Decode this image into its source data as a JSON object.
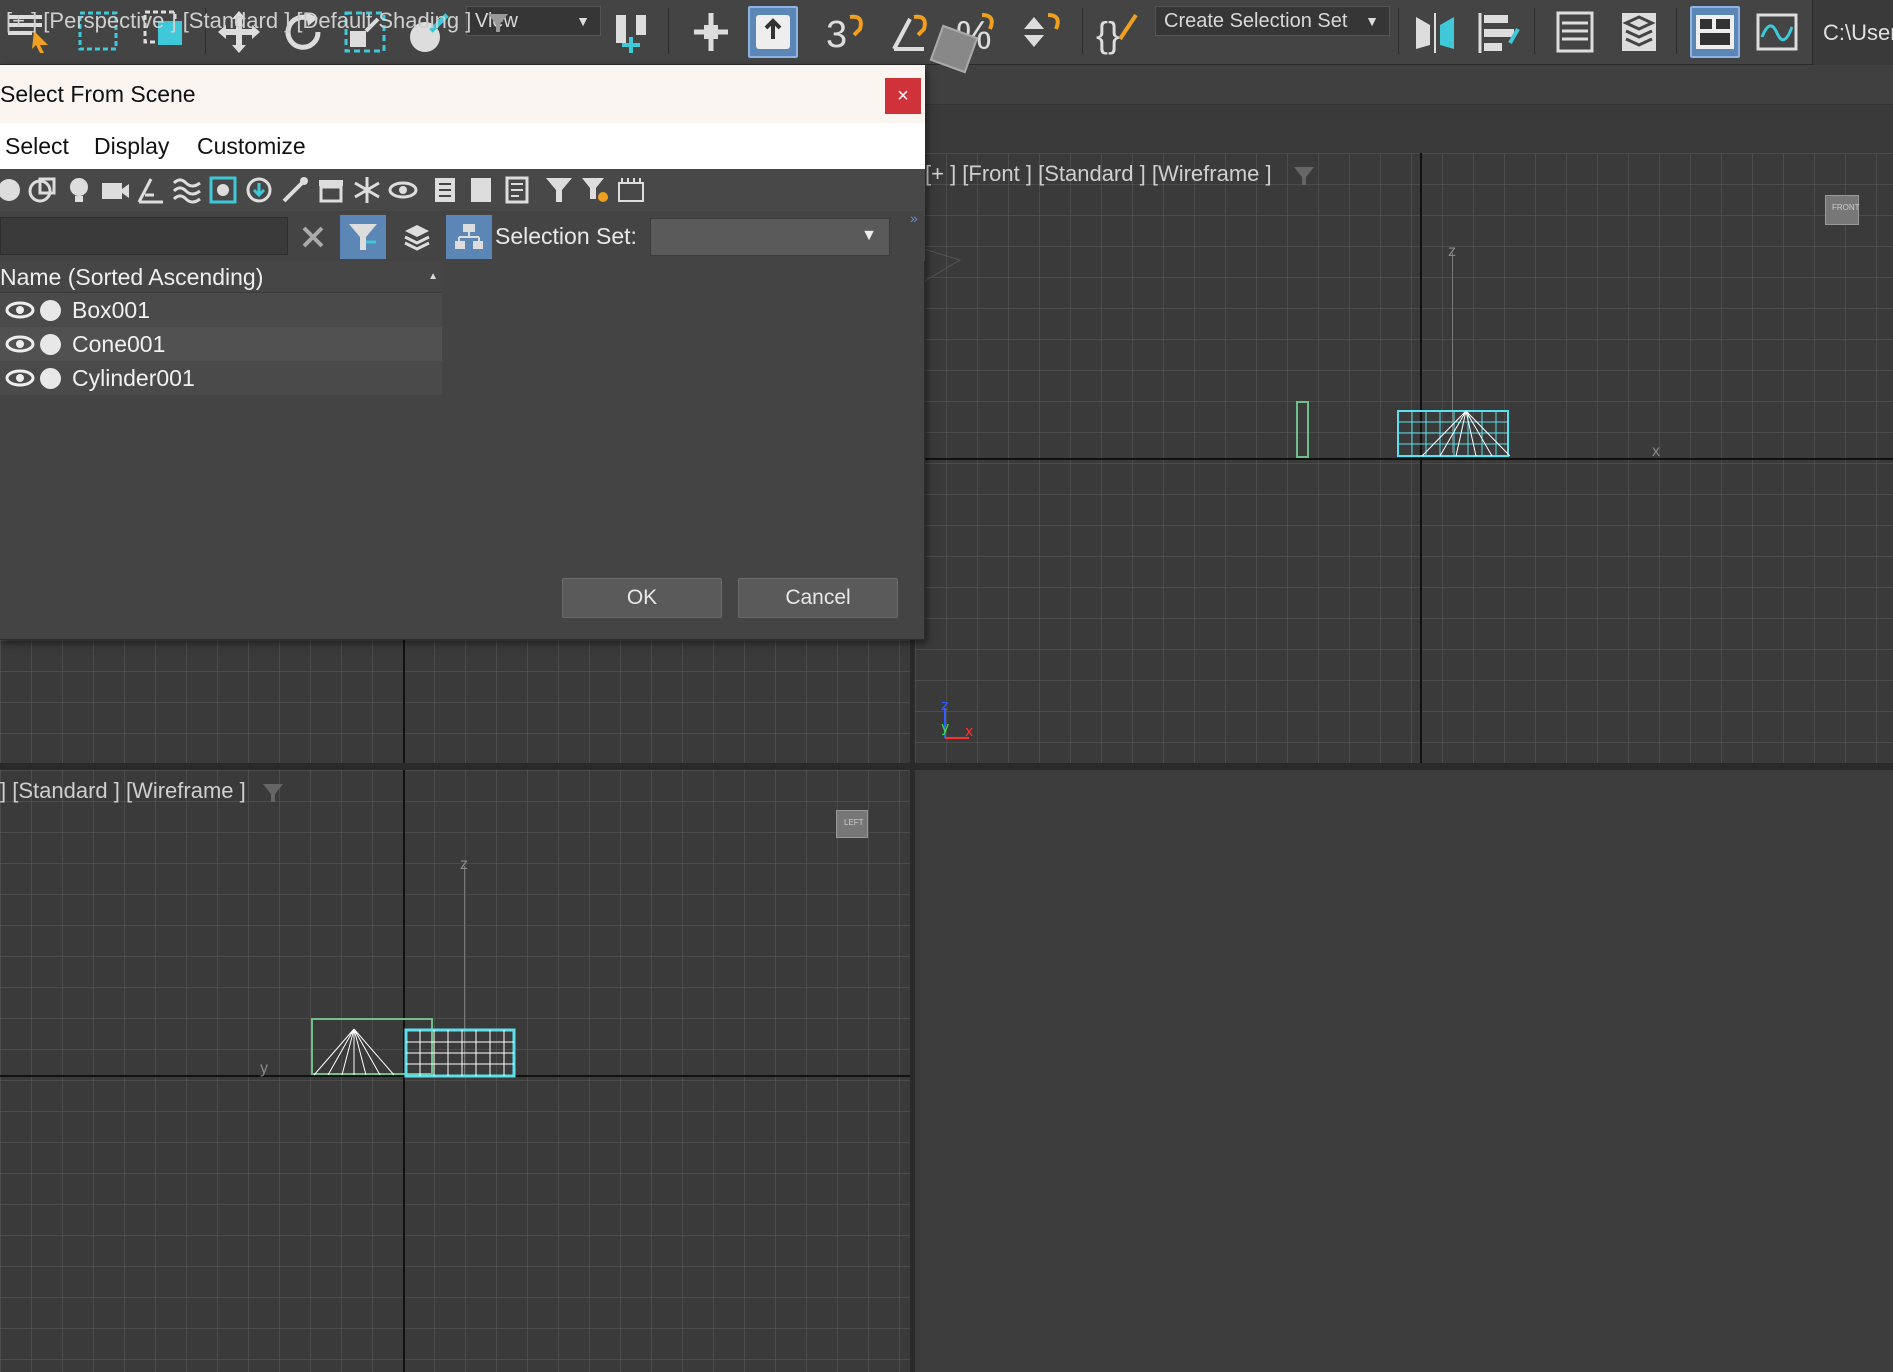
{
  "toolbar": {
    "view_dropdown": "View",
    "selection_set_dropdown": "Create Selection Set",
    "path_text": "C:\\User"
  },
  "dialog": {
    "title": "Select From Scene",
    "close_glyph": "×",
    "menu": [
      "Select",
      "Display",
      "Customize"
    ],
    "search_placeholder": "",
    "selection_set_label": "Selection Set:",
    "selection_set_value": "",
    "list_header": "Name (Sorted Ascending)",
    "objects": [
      {
        "name": "Box001"
      },
      {
        "name": "Cone001"
      },
      {
        "name": "Cylinder001"
      }
    ],
    "ok_label": "OK",
    "cancel_label": "Cancel"
  },
  "viewports": {
    "front": {
      "label": "[+ ] [Front ] [Standard ] [Wireframe ]",
      "gizmo_label": "FRONT"
    },
    "left": {
      "label": "] [Standard ] [Wireframe ]",
      "gizmo_label": "LEFT"
    },
    "perspective": {
      "label": "[+ ] [Perspective ] [Standard ] [Default Shading ]"
    }
  },
  "axis_letters": {
    "x": "x",
    "y": "y",
    "z": "z"
  },
  "colors": {
    "selection_highlight": "#5de0ee",
    "active_button": "#5b86b5",
    "box_green": "#5e9a76",
    "cylinder_gold": "#c5ad3a",
    "cone_gray": "#b5c3c6",
    "close_red": "#d0323a",
    "perspective_border": "#a08a38"
  }
}
